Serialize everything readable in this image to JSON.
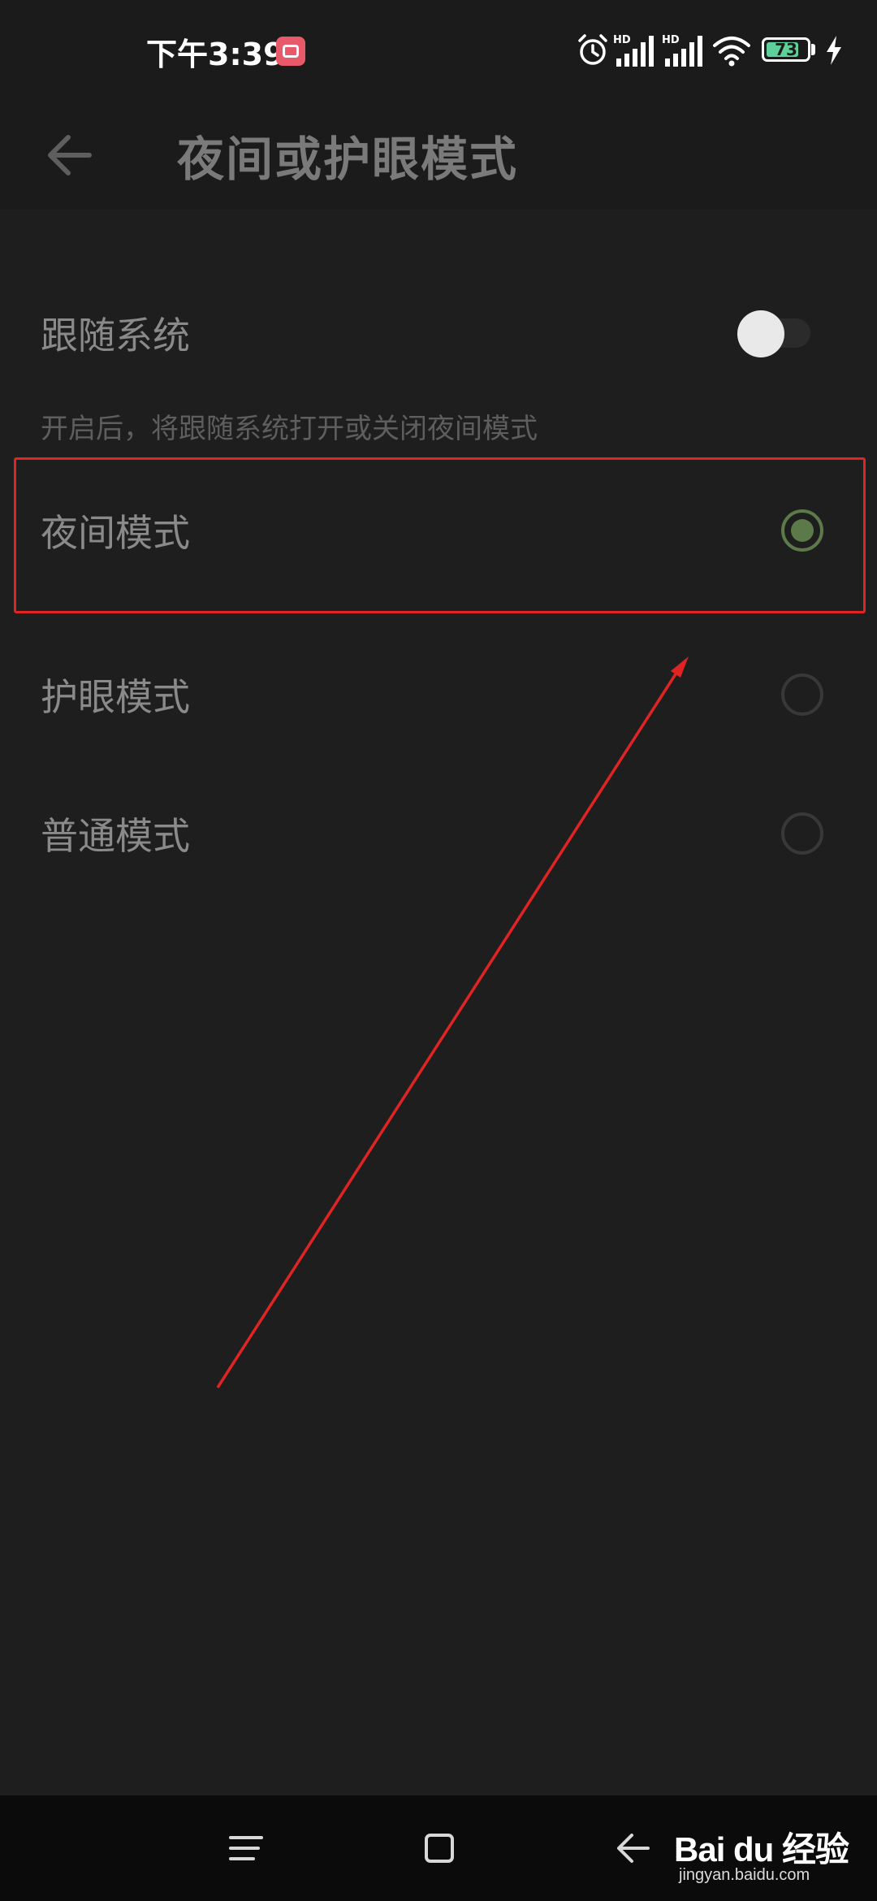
{
  "status_bar": {
    "time": "下午3:39",
    "battery_level": "73",
    "signal_label_1": "HD",
    "signal_label_2": "HD",
    "icons": [
      "alarm-icon",
      "signal-icon",
      "signal-icon",
      "wifi-icon",
      "battery-icon",
      "charging-icon"
    ]
  },
  "header": {
    "title": "夜间或护眼模式",
    "back_icon": "arrow-left-icon"
  },
  "settings": {
    "follow_system": {
      "label": "跟随系统",
      "enabled": false,
      "description": "开启后，将跟随系统打开或关闭夜间模式"
    },
    "modes": [
      {
        "label": "夜间模式",
        "selected": true
      },
      {
        "label": "护眼模式",
        "selected": false
      },
      {
        "label": "普通模式",
        "selected": false
      }
    ]
  },
  "nav_bar": {
    "icons": [
      "menu-icon",
      "home-icon",
      "back-icon"
    ]
  },
  "watermark": {
    "brand": "Bai du 经验",
    "url": "jingyan.baidu.com"
  },
  "colors": {
    "background": "#1e1e1e",
    "accent": "#5c7a49",
    "annotation": "#e02424",
    "battery": "#5fd09a"
  }
}
